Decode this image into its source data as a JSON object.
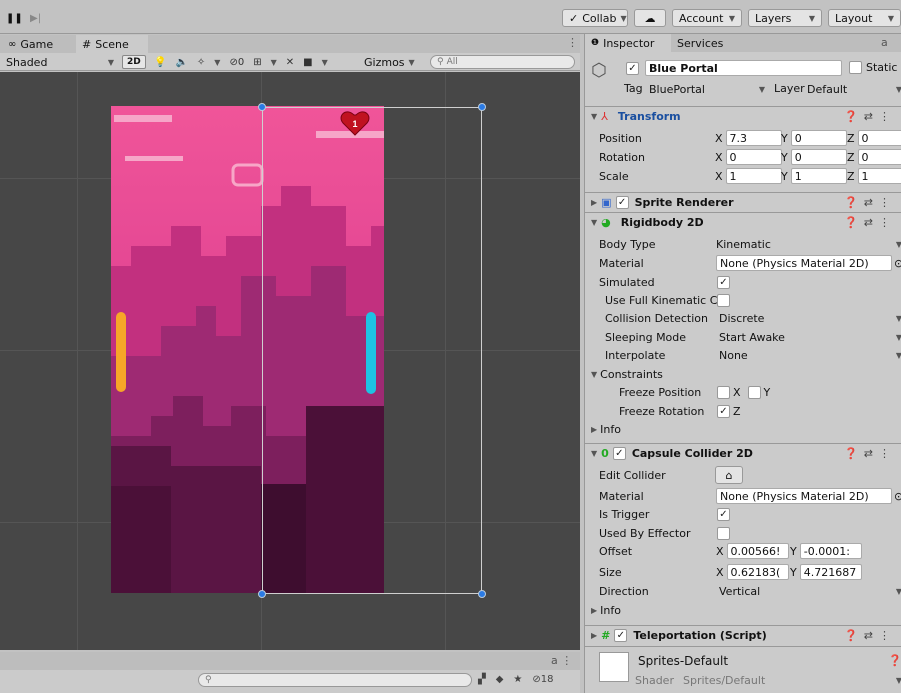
{
  "toolbar": {
    "collab": "Collab",
    "account": "Account",
    "layers": "Layers",
    "layout": "Layout"
  },
  "scene_tabs": {
    "game": "Game",
    "scene": "Scene",
    "shaded": "Shaded",
    "mode_2d": "2D",
    "fx_count": "0",
    "gizmos": "Gizmos",
    "search_placeholder": "All"
  },
  "game": {
    "lives": "1"
  },
  "bottom": {
    "hidden_count": "18"
  },
  "inspector": {
    "tabs": {
      "inspector": "Inspector",
      "services": "Services"
    },
    "object": {
      "name": "Blue Portal",
      "static_label": "Static",
      "tag_label": "Tag",
      "tag": "BluePortal",
      "layer_label": "Layer",
      "layer": "Default"
    },
    "transform": {
      "title": "Transform",
      "rows": [
        {
          "label": "Position",
          "x": "7.3",
          "y": "0",
          "z": "0"
        },
        {
          "label": "Rotation",
          "x": "0",
          "y": "0",
          "z": "0"
        },
        {
          "label": "Scale",
          "x": "1",
          "y": "1",
          "z": "1"
        }
      ]
    },
    "sprite_renderer": {
      "title": "Sprite Renderer"
    },
    "rigidbody": {
      "title": "Rigidbody 2D",
      "body_type_label": "Body Type",
      "body_type": "Kinematic",
      "material_label": "Material",
      "material": "None (Physics Material 2D)",
      "simulated_label": "Simulated",
      "full_kinematic_label": "Use Full Kinematic Cc",
      "collision_label": "Collision Detection",
      "collision": "Discrete",
      "sleeping_label": "Sleeping Mode",
      "sleeping": "Start Awake",
      "interpolate_label": "Interpolate",
      "interpolate": "None",
      "constraints_label": "Constraints",
      "freeze_pos_label": "Freeze Position",
      "freeze_rot_label": "Freeze Rotation",
      "x": "X",
      "y": "Y",
      "z": "Z",
      "info": "Info"
    },
    "capsule": {
      "title": "Capsule Collider 2D",
      "edit_label": "Edit Collider",
      "material_label": "Material",
      "material": "None (Physics Material 2D)",
      "trigger_label": "Is Trigger",
      "effector_label": "Used By Effector",
      "offset_label": "Offset",
      "offset_x": "0.00566!",
      "offset_y": "-0.0001:",
      "size_label": "Size",
      "size_x": "0.62183(",
      "size_y": "4.721687",
      "direction_label": "Direction",
      "direction": "Vertical",
      "info": "Info"
    },
    "teleport": {
      "title": "Teleportation (Script)"
    },
    "material": {
      "name": "Sprites-Default",
      "shader_label": "Shader",
      "shader": "Sprites/Default"
    }
  }
}
